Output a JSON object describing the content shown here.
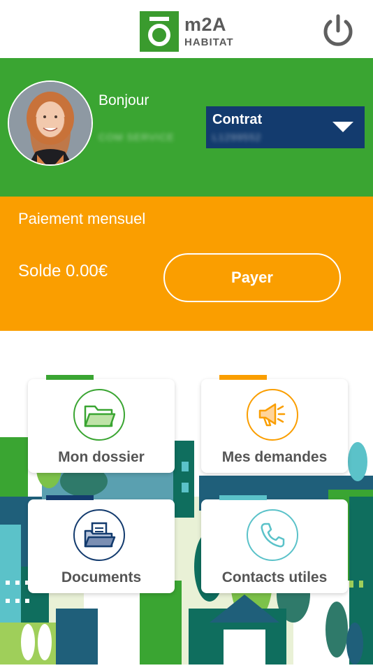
{
  "header": {
    "logo_main": "m2A",
    "logo_sub": "HABITAT",
    "power_icon": "power-icon"
  },
  "user": {
    "greeting": "Bonjour",
    "name": "COM SERVICE",
    "contract_label": "Contrat",
    "contract_number": "L1299552"
  },
  "payment": {
    "title": "Paiement mensuel",
    "balance": "Solde 0.00€",
    "pay_label": "Payer"
  },
  "tiles": [
    {
      "label": "Mon dossier",
      "icon": "folder-icon",
      "accent": "#3aa532"
    },
    {
      "label": "Mes demandes",
      "icon": "megaphone-icon",
      "accent": "#fa9e00"
    },
    {
      "label": "Documents",
      "icon": "documents-icon",
      "accent": "#133b6e"
    },
    {
      "label": "Contacts utiles",
      "icon": "phone-icon",
      "accent": "#5bc2c9"
    }
  ],
  "colors": {
    "green": "#3aa532",
    "orange": "#fa9e00",
    "navy": "#133b6e",
    "teal": "#5bc2c9"
  }
}
